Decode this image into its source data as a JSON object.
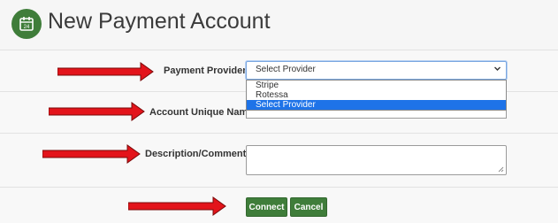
{
  "header": {
    "title": "New Payment Account",
    "icon": "calendar-icon",
    "icon_text": "24"
  },
  "form": {
    "payment_provider": {
      "label": "Payment Provider:",
      "selected": "Select Provider",
      "options": [
        "Stripe",
        "Rotessa",
        "Select Provider"
      ],
      "highlighted": "Select Provider"
    },
    "account_unique_name": {
      "label": "Account Unique Name:",
      "value": ""
    },
    "description": {
      "label": "Description/Comments:",
      "value": ""
    }
  },
  "buttons": {
    "connect": "Connect",
    "cancel": "Cancel"
  },
  "colors": {
    "brand_green": "#3f7d3a",
    "arrow_red": "#e3141b",
    "highlight_blue": "#1e73e8"
  }
}
